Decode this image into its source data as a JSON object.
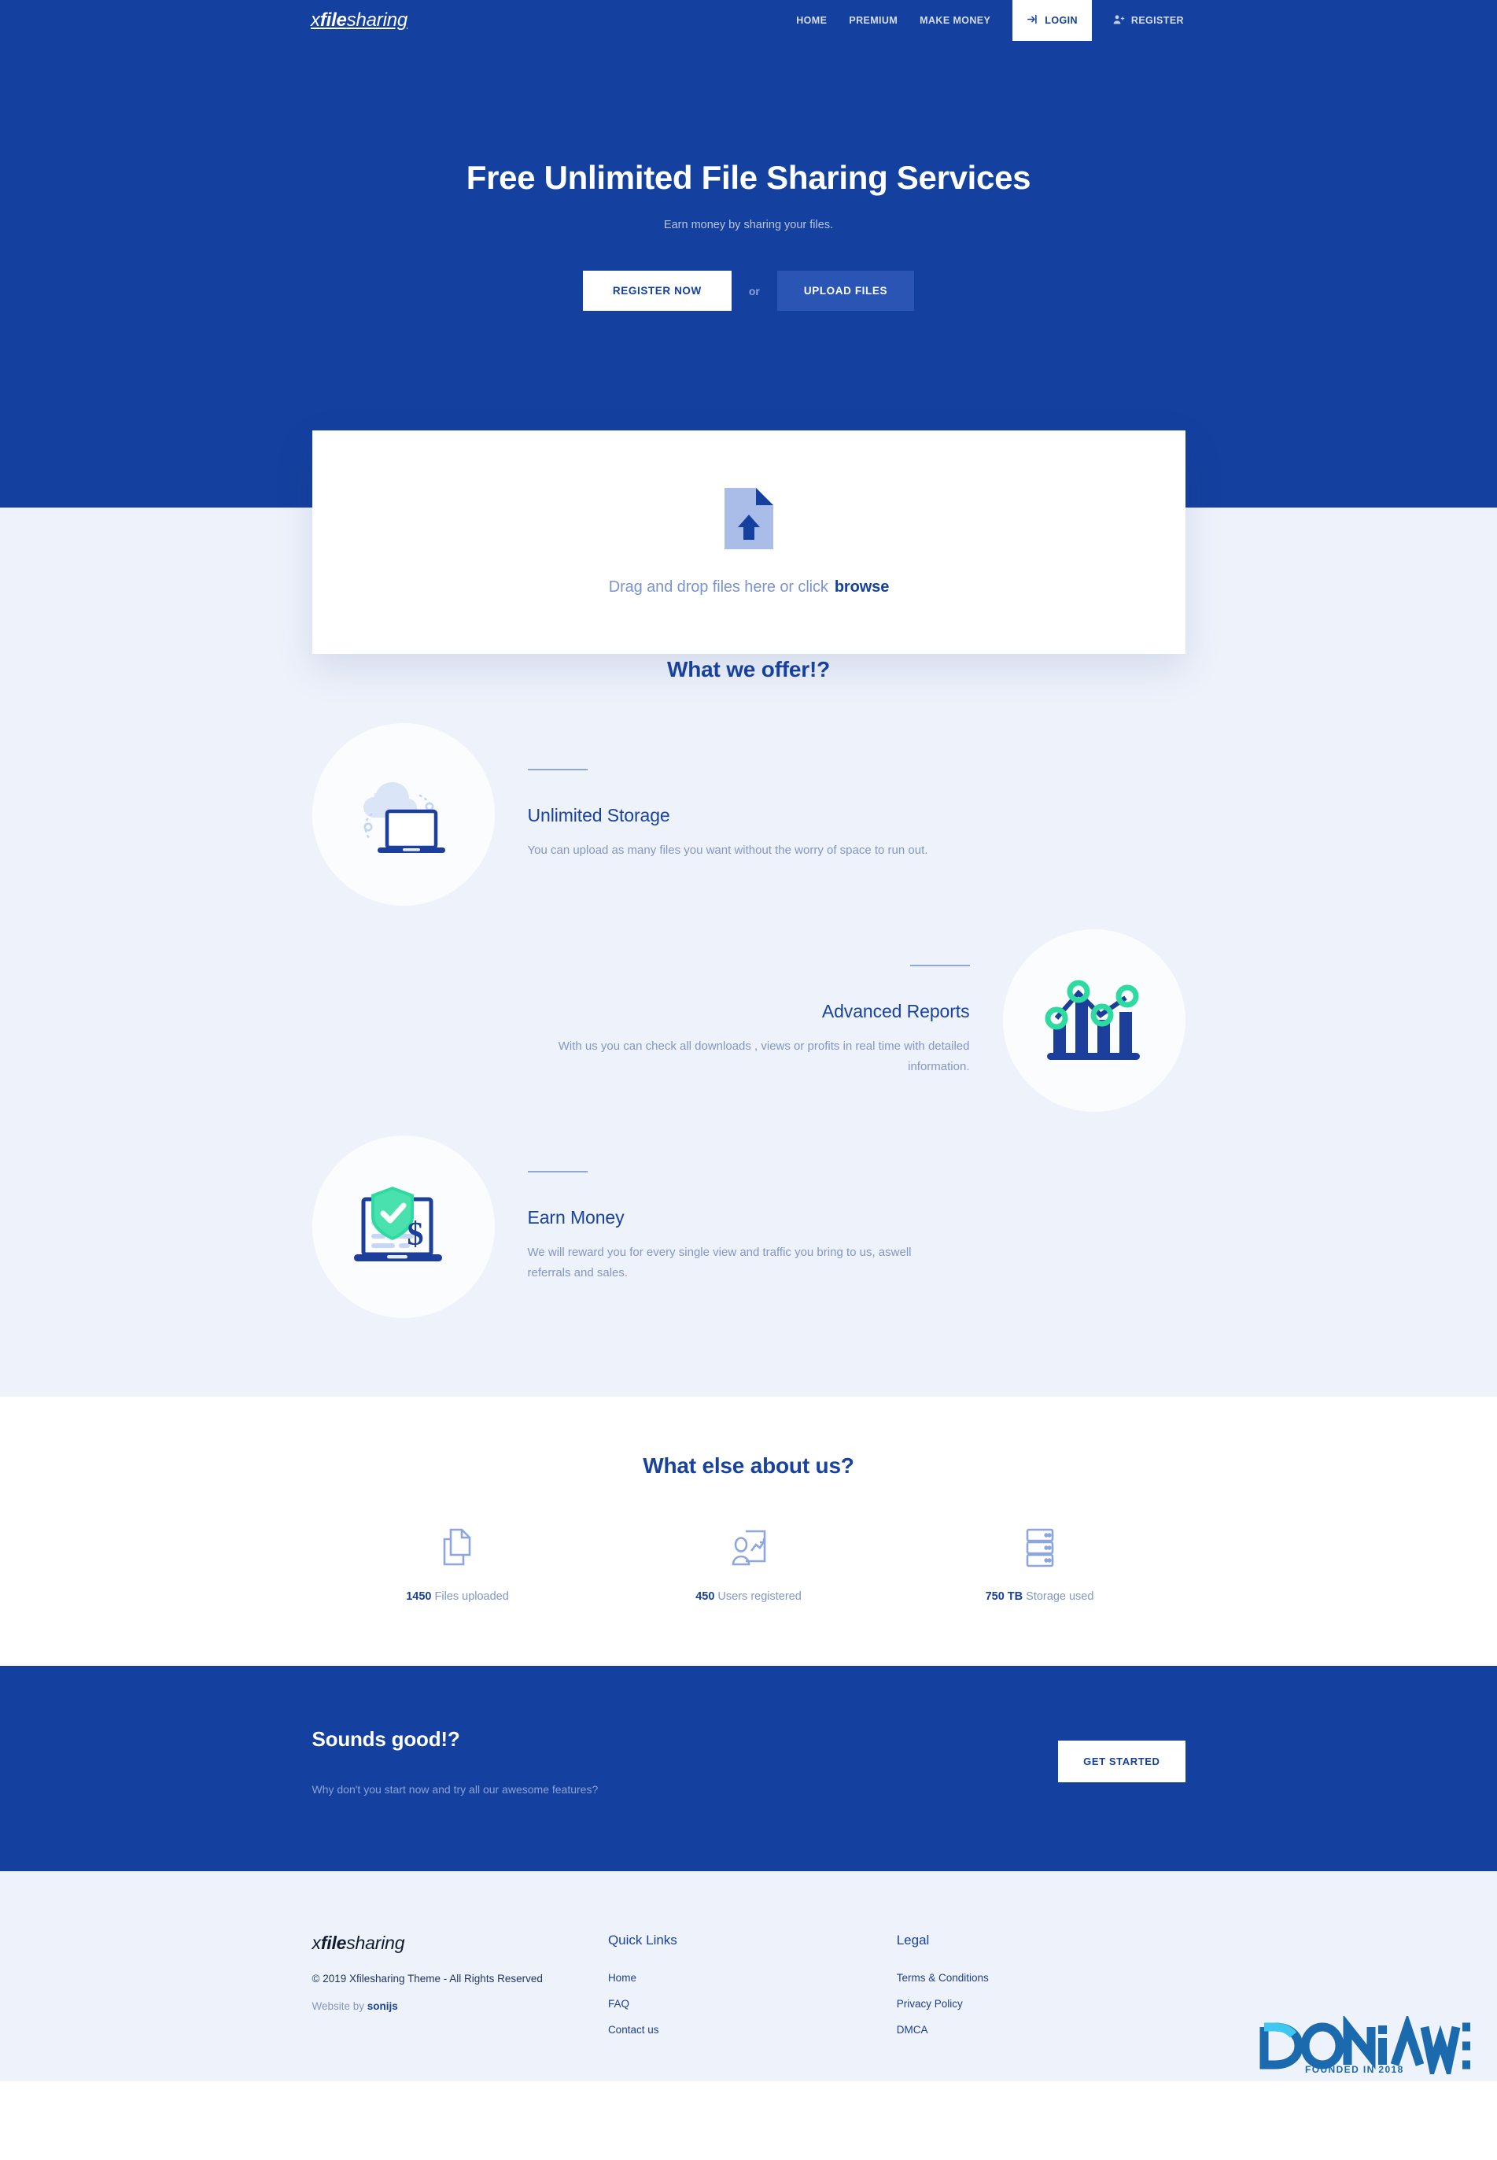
{
  "header": {
    "brand": {
      "part1": "x",
      "part2": "file",
      "part3": "sharing"
    },
    "nav": [
      {
        "label": "HOME",
        "name": "nav-home"
      },
      {
        "label": "PREMIUM",
        "name": "nav-premium"
      },
      {
        "label": "MAKE MONEY",
        "name": "nav-make-money"
      }
    ],
    "login_label": "LOGIN",
    "register_label": "REGISTER"
  },
  "hero": {
    "title": "Free Unlimited File Sharing Services",
    "subtitle": "Earn money by sharing your files.",
    "primary_button": "REGISTER NOW",
    "or_text": "or",
    "secondary_button": "UPLOAD FILES"
  },
  "upload": {
    "text": "Drag and drop files here or click",
    "browse_label": "browse"
  },
  "offer": {
    "title": "What we offer!?",
    "features": [
      {
        "title": "Unlimited Storage",
        "desc": "You can upload as many files you want without the worry of space to run out.",
        "icon": "cloud-laptop-icon"
      },
      {
        "title": "Advanced Reports",
        "desc": "With us you can check all downloads , views or profits in real time with detailed information.",
        "icon": "bar-chart-icon"
      },
      {
        "title": "Earn Money",
        "desc": "We will reward you for every single view and traffic you bring to us, aswell referrals and sales.",
        "icon": "shield-dollar-laptop-icon"
      }
    ]
  },
  "stats": {
    "title": "What else about us?",
    "items": [
      {
        "value": "1450",
        "label": "Files uploaded",
        "icon": "files-icon"
      },
      {
        "value": "450",
        "label": "Users registered",
        "icon": "user-chart-icon"
      },
      {
        "value": "750 TB",
        "label": "Storage used",
        "icon": "server-icon"
      }
    ]
  },
  "cta": {
    "title": "Sounds good!?",
    "subtitle": "Why don't you start now and try all our awesome features?",
    "button": "GET STARTED"
  },
  "footer": {
    "brand": {
      "part1": "x",
      "part2": "file",
      "part3": "sharing"
    },
    "copyright": "© 2019 Xfilesharing Theme - All Rights Reserved",
    "website_by_prefix": "Website by ",
    "website_by_name": "sonijs",
    "quick_links_title": "Quick Links",
    "quick_links": [
      {
        "label": "Home"
      },
      {
        "label": "FAQ"
      },
      {
        "label": "Contact us"
      }
    ],
    "legal_title": "Legal",
    "legal_links": [
      {
        "label": "Terms & Conditions"
      },
      {
        "label": "Privacy Policy"
      },
      {
        "label": "DMCA"
      }
    ],
    "watermark": {
      "text": "DONiAWEB",
      "tagline": "FOUNDED IN 2018"
    }
  },
  "colors": {
    "brand_blue": "#14409f",
    "light_bg": "#eef2fb",
    "muted_text": "#8296c8",
    "accent_green": "#2ddba0"
  }
}
